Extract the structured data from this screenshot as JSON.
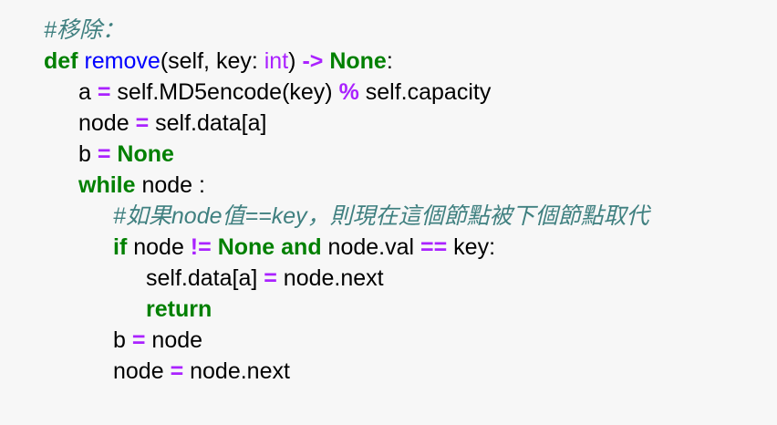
{
  "code": {
    "line1": {
      "comment": "#移除："
    },
    "line2": {
      "kw_def": "def",
      "space1": " ",
      "func": "remove",
      "args_open": "(self, key: ",
      "builtin_int": "int",
      "args_close": ") ",
      "arrow": "->",
      "space2": " ",
      "kw_none": "None",
      "colon": ":"
    },
    "line3": {
      "lhs": "a ",
      "eq": "=",
      "mid": " self.MD5encode(key) ",
      "mod": "%",
      "rhs": " self.capacity"
    },
    "line4": {
      "lhs": "node ",
      "eq": "=",
      "rhs": " self.data[a]"
    },
    "line5": {
      "lhs": "b ",
      "eq": "=",
      "space": " ",
      "kw_none": "None"
    },
    "line6": {
      "kw_while": "while",
      "rest": " node :"
    },
    "line7": {
      "comment": "#如果node值==key，則現在這個節點被下個節點取代"
    },
    "line8": {
      "kw_if": "if",
      "part1": " node ",
      "neq": "!=",
      "space1": " ",
      "kw_none": "None",
      "space2": " ",
      "kw_and": "and",
      "part2": " node.val ",
      "eqeq": "==",
      "part3": " key:"
    },
    "line9": {
      "lhs": "self.data[a] ",
      "eq": "=",
      "rhs": " node.next"
    },
    "line10": {
      "kw_return": "return"
    },
    "line11": {
      "lhs": "b ",
      "eq": "=",
      "rhs": " node"
    },
    "line12": {
      "lhs": "node ",
      "eq": "=",
      "rhs": " node.next"
    }
  },
  "colors": {
    "background": "#f7f7f7",
    "comment": "#408080",
    "keyword": "#008000",
    "operator": "#aa22ff",
    "function_name": "#0000ff",
    "text": "#000000"
  }
}
